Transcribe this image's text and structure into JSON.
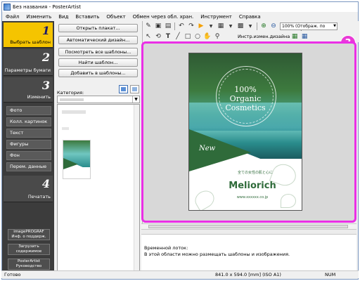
{
  "window": {
    "title": "Без названия - PosterArtist"
  },
  "menu": [
    "Файл",
    "Изменить",
    "Вид",
    "Вставить",
    "Объект",
    "Обмен через обл. хран.",
    "Инструмент",
    "Справка"
  ],
  "nav": {
    "steps": [
      {
        "num": "1",
        "label": "Выбрать шаблон"
      },
      {
        "num": "2",
        "label": "Параметры бумаги"
      },
      {
        "num": "3",
        "label": "Изменить"
      },
      {
        "num": "4",
        "label": "Печатать"
      }
    ],
    "sub_items": [
      "Фото",
      "Колл. картинок",
      "Текст",
      "Фигуры",
      "Фон",
      "Перем. данные"
    ],
    "bottom": [
      {
        "line1": "imagePROGRAF",
        "line2": "Инф. о поддерж."
      },
      {
        "line1": "Загрузить",
        "line2": "содержимое"
      },
      {
        "line1": "PosterArtist",
        "line2": "Руководство"
      }
    ]
  },
  "templates": {
    "buttons": [
      "Открыть плакат...",
      "Автоматический дизайн...",
      "Посмотреть все шаблоны...",
      "Найти шаблон...",
      "Добавить в шаблоны..."
    ],
    "category_label": "Категория:"
  },
  "toolbar": {
    "zoom": "100% (Отображ. по размеру)",
    "tool_label": "Инстр.измен.дизайна"
  },
  "callout": "3",
  "poster": {
    "line1": "100%",
    "line2": "Organic",
    "line3": "Cosmetics",
    "new": "New",
    "japanese": "全ての女性の肌と心に",
    "brand": "Meliorich",
    "url": "www.xxxxxx.co.jp"
  },
  "tray": {
    "title": "Временной лоток:",
    "desc": "В этой области можно размещать шаблоны и изображения."
  },
  "status": {
    "left": "Готово",
    "size": "841.0 x 594.0 [mm] (ISO A1)",
    "num": "NUM"
  }
}
